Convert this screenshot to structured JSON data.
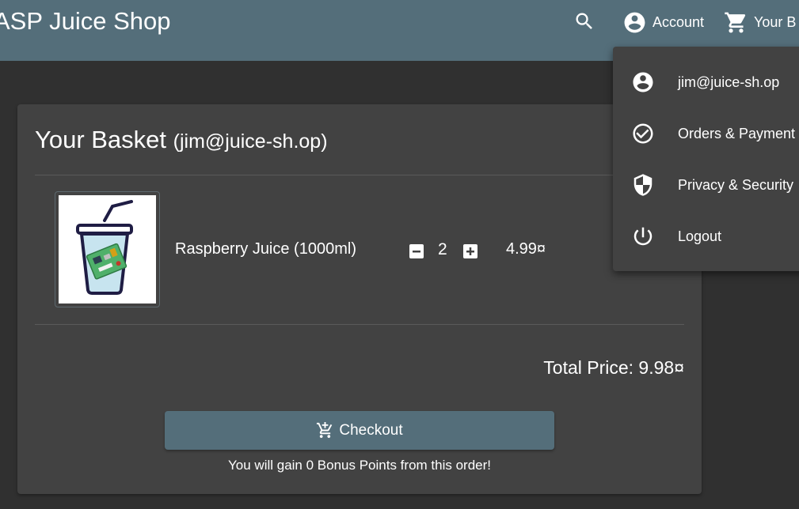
{
  "header": {
    "app_title": "ASP Juice Shop",
    "search_icon": "search-icon",
    "account_label": "Account",
    "basket_label": "Your B"
  },
  "account_menu": {
    "items": [
      {
        "label": "jim@juice-sh.op",
        "icon": "account-circle-icon"
      },
      {
        "label": "Orders & Payment",
        "icon": "check-circle-icon"
      },
      {
        "label": "Privacy & Security",
        "icon": "shield-icon"
      },
      {
        "label": "Logout",
        "icon": "power-icon"
      }
    ]
  },
  "basket": {
    "title": "Your Basket",
    "user_email": "(jim@juice-sh.op)",
    "items": [
      {
        "name": "Raspberry Juice (1000ml)",
        "quantity": "2",
        "price": "4.99¤"
      }
    ],
    "total_label": "Total Price: 9.98¤",
    "checkout_label": "Checkout",
    "bonus_text": "You will gain 0 Bonus Points from this order!"
  },
  "colors": {
    "toolbar": "#546e7a",
    "background": "#303030",
    "card": "#424242",
    "checkout_button": "#546e7a"
  }
}
